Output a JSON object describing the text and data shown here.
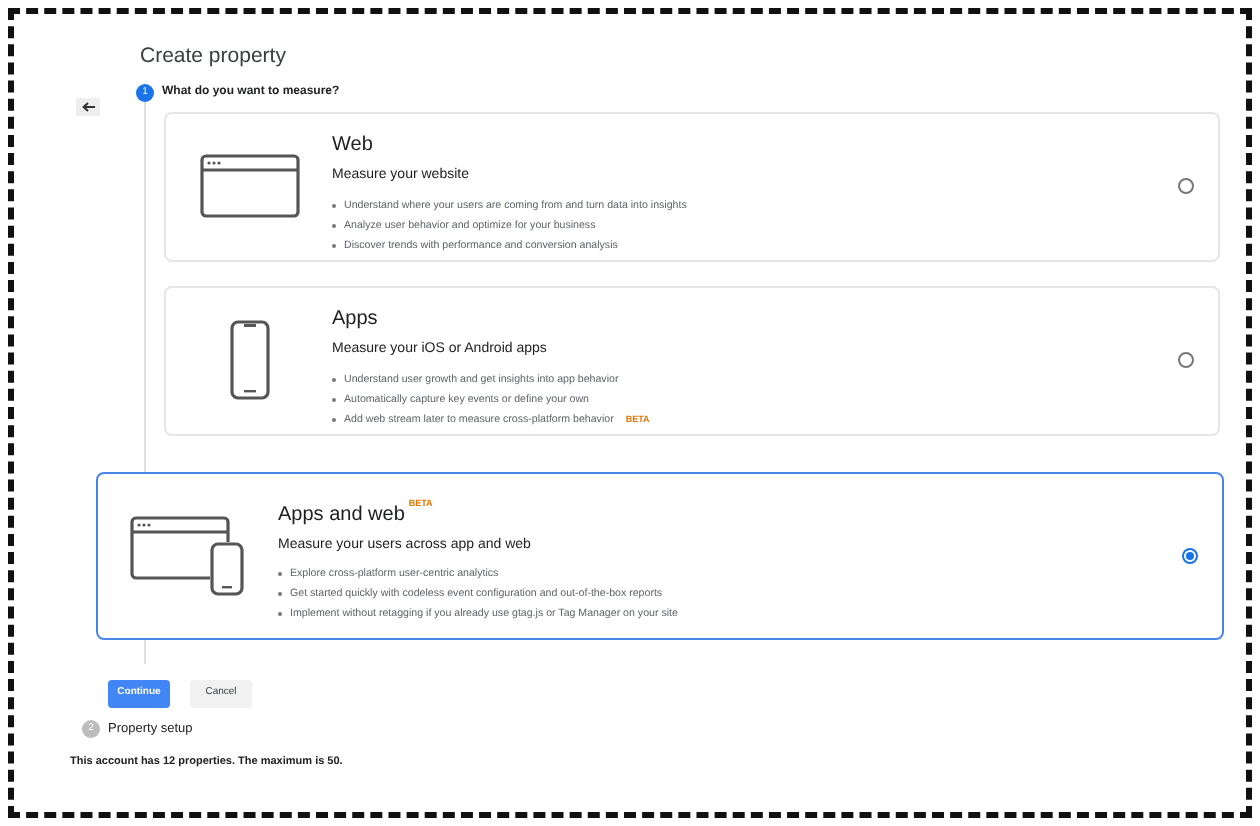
{
  "title": "Create property",
  "steps": [
    {
      "number": "1",
      "label": "What do you want to measure?",
      "active": true
    },
    {
      "number": "2",
      "label": "Property setup",
      "active": false
    }
  ],
  "options": [
    {
      "kind": "web",
      "title": "Web",
      "subtitle": "Measure your website",
      "selected": false,
      "bullets": [
        {
          "text": "Understand where your users are coming from and turn data into insights"
        },
        {
          "text": "Analyze user behavior and optimize for your business"
        },
        {
          "text": "Discover trends with performance and conversion analysis"
        }
      ]
    },
    {
      "kind": "app",
      "title": "Apps",
      "subtitle": "Measure your iOS or Android apps",
      "selected": false,
      "bullets": [
        {
          "text": "Understand user growth and get insights into app behavior"
        },
        {
          "text": "Automatically capture key events or define your own"
        },
        {
          "text": "Add web stream later to measure cross-platform behavior",
          "badge": "BETA"
        }
      ]
    },
    {
      "kind": "both",
      "title": "Apps and web",
      "badge": "BETA",
      "subtitle": "Measure your users across app and web",
      "selected": true,
      "bullets": [
        {
          "text": "Explore cross-platform user-centric analytics"
        },
        {
          "text": "Get started quickly with codeless event configuration and out-of-the-box reports"
        },
        {
          "text": "Implement without retagging if you already use gtag.js or Tag Manager on your site"
        }
      ]
    }
  ],
  "buttons": [
    {
      "label": "Continue",
      "kind": "primary"
    },
    {
      "label": "Cancel",
      "kind": "secondary"
    }
  ],
  "footer": "This account has 12 properties. The maximum is 50."
}
